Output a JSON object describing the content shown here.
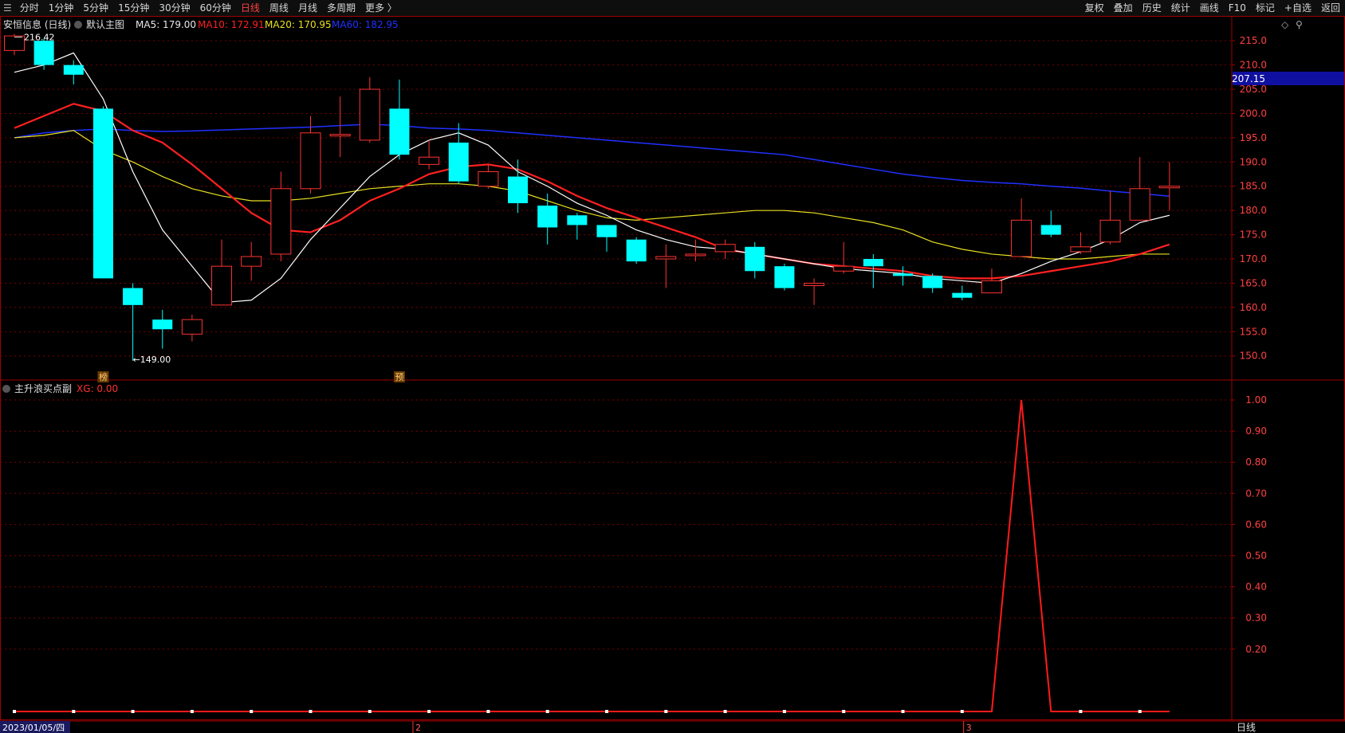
{
  "toolbar": {
    "left_items": [
      "分时",
      "1分钟",
      "5分钟",
      "15分钟",
      "30分钟",
      "60分钟",
      "日线",
      "周线",
      "月线",
      "多周期",
      "更多 〉"
    ],
    "active_index": 6,
    "right_items": [
      "复权",
      "叠加",
      "历史",
      "统计",
      "画线",
      "F10",
      "标记",
      "+自选",
      "返回"
    ]
  },
  "main_panel": {
    "stock_label": "安恒信息 (日线)",
    "template_label": "默认主图",
    "ma5": {
      "label": "MA5: 179.00",
      "color": "#ffffff"
    },
    "ma10": {
      "label": "MA10: 172.91",
      "color": "#ff2020"
    },
    "ma20": {
      "label": "MA20: 170.95",
      "color": "#e8e020"
    },
    "ma60": {
      "label": "MA60: 182.95",
      "color": "#2030ff"
    },
    "high_label": "216.42",
    "low_label": "149.00",
    "price_tag": "207.15",
    "marker_1": "榜",
    "marker_2": "预",
    "y_ticks": [
      "215.0",
      "210.0",
      "205.0",
      "200.0",
      "195.0",
      "190.0",
      "185.0",
      "180.0",
      "175.0",
      "170.0",
      "165.0",
      "160.0",
      "155.0",
      "150.0"
    ]
  },
  "sub_panel": {
    "indicator_label": "主升浪买点副",
    "xg_label": "XG: 0.00",
    "y_ticks": [
      "1.00",
      "0.90",
      "0.80",
      "0.70",
      "0.60",
      "0.50",
      "0.40",
      "0.30",
      "0.20"
    ]
  },
  "x_axis": {
    "start_date": "2023/01/05/四",
    "month_marks": [
      "2",
      "3"
    ],
    "period_label": "日线"
  },
  "colors": {
    "up": "#ff3232",
    "down": "#00ffff",
    "grid": "#7a0000",
    "axis_border": "#a00000",
    "signal": "#ff1a1a"
  },
  "chart_data": {
    "type": "candlestick",
    "y_range": [
      147,
      217
    ],
    "candles": [
      {
        "o": 213.0,
        "c": 216.0,
        "h": 216.42,
        "l": 212.0
      },
      {
        "o": 215.0,
        "c": 210.0,
        "h": 215.5,
        "l": 209.0
      },
      {
        "o": 210.0,
        "c": 208.0,
        "h": 211.0,
        "l": 206.0
      },
      {
        "o": 201.0,
        "c": 166.0,
        "h": 201.5,
        "l": 166.0
      },
      {
        "o": 164.0,
        "c": 160.5,
        "h": 165.0,
        "l": 149.0
      },
      {
        "o": 157.5,
        "c": 155.5,
        "h": 159.5,
        "l": 151.5
      },
      {
        "o": 154.5,
        "c": 157.5,
        "h": 158.5,
        "l": 153.0
      },
      {
        "o": 160.5,
        "c": 168.5,
        "h": 174.0,
        "l": 160.5
      },
      {
        "o": 168.5,
        "c": 170.5,
        "h": 173.5,
        "l": 165.5
      },
      {
        "o": 171.0,
        "c": 184.5,
        "h": 188.0,
        "l": 169.5
      },
      {
        "o": 184.5,
        "c": 196.0,
        "h": 199.5,
        "l": 183.5
      },
      {
        "o": 195.7,
        "c": 195.7,
        "h": 203.5,
        "l": 191.0
      },
      {
        "o": 194.5,
        "c": 205.0,
        "h": 207.5,
        "l": 194.0
      },
      {
        "o": 201.0,
        "c": 191.5,
        "h": 207.0,
        "l": 190.5
      },
      {
        "o": 189.5,
        "c": 191.0,
        "h": 194.5,
        "l": 188.5
      },
      {
        "o": 194.0,
        "c": 186.0,
        "h": 198.0,
        "l": 185.5
      },
      {
        "o": 185.0,
        "c": 188.0,
        "h": 189.5,
        "l": 184.5
      },
      {
        "o": 187.0,
        "c": 181.5,
        "h": 190.5,
        "l": 179.5
      },
      {
        "o": 181.0,
        "c": 176.5,
        "h": 183.5,
        "l": 173.0
      },
      {
        "o": 179.0,
        "c": 177.0,
        "h": 179.5,
        "l": 174.0
      },
      {
        "o": 177.0,
        "c": 174.5,
        "h": 177.0,
        "l": 171.5
      },
      {
        "o": 174.0,
        "c": 169.5,
        "h": 174.5,
        "l": 169.0
      },
      {
        "o": 170.0,
        "c": 170.5,
        "h": 173.0,
        "l": 164.0
      },
      {
        "o": 171.0,
        "c": 171.0,
        "h": 174.0,
        "l": 169.5
      },
      {
        "o": 171.5,
        "c": 173.0,
        "h": 174.0,
        "l": 170.0
      },
      {
        "o": 172.5,
        "c": 167.5,
        "h": 173.5,
        "l": 166.0
      },
      {
        "o": 168.5,
        "c": 164.0,
        "h": 169.0,
        "l": 163.5
      },
      {
        "o": 164.5,
        "c": 165.0,
        "h": 166.0,
        "l": 160.5
      },
      {
        "o": 167.5,
        "c": 168.5,
        "h": 173.5,
        "l": 167.0
      },
      {
        "o": 170.0,
        "c": 168.5,
        "h": 171.0,
        "l": 164.0
      },
      {
        "o": 167.0,
        "c": 166.5,
        "h": 168.5,
        "l": 164.5
      },
      {
        "o": 166.5,
        "c": 164.0,
        "h": 167.0,
        "l": 163.0
      },
      {
        "o": 163.0,
        "c": 162.0,
        "h": 164.5,
        "l": 161.5
      },
      {
        "o": 163.0,
        "c": 165.5,
        "h": 168.0,
        "l": 163.0
      },
      {
        "o": 170.5,
        "c": 178.0,
        "h": 182.5,
        "l": 170.5
      },
      {
        "o": 177.0,
        "c": 175.0,
        "h": 180.0,
        "l": 174.5
      },
      {
        "o": 171.5,
        "c": 172.5,
        "h": 175.5,
        "l": 171.0
      },
      {
        "o": 173.5,
        "c": 178.0,
        "h": 184.0,
        "l": 173.0
      },
      {
        "o": 178.0,
        "c": 184.5,
        "h": 191.0,
        "l": 178.0
      },
      {
        "o": 185.0,
        "c": 185.0,
        "h": 190.0,
        "l": 180.0
      }
    ],
    "ma5": [
      208.5,
      210.0,
      212.5,
      203.0,
      188.0,
      176.0,
      168.5,
      161.0,
      161.5,
      166.0,
      174.0,
      180.5,
      187.0,
      191.5,
      194.5,
      196.0,
      193.5,
      188.0,
      185.0,
      181.5,
      179.0,
      176.0,
      174.0,
      172.5,
      172.0,
      171.0,
      170.0,
      169.0,
      168.0,
      167.5,
      167.0,
      166.0,
      165.5,
      165.0,
      167.0,
      169.5,
      171.5,
      174.0,
      177.5,
      179.0
    ],
    "ma10": [
      197.0,
      199.5,
      202.0,
      200.5,
      196.5,
      194.0,
      189.5,
      184.5,
      179.5,
      176.0,
      175.5,
      178.0,
      182.0,
      184.5,
      187.5,
      189.0,
      189.5,
      188.5,
      186.0,
      183.0,
      180.5,
      178.5,
      176.5,
      174.5,
      172.0,
      171.0,
      170.0,
      169.0,
      168.5,
      168.0,
      167.5,
      166.5,
      166.0,
      166.0,
      166.5,
      167.5,
      168.5,
      169.5,
      171.0,
      173.0
    ],
    "ma20": [
      195.0,
      195.5,
      196.5,
      192.5,
      190.0,
      187.0,
      184.5,
      183.0,
      182.0,
      182.0,
      182.5,
      183.5,
      184.5,
      185.0,
      185.5,
      185.5,
      185.0,
      184.0,
      182.0,
      180.0,
      178.5,
      178.0,
      178.5,
      179.0,
      179.5,
      180.0,
      180.0,
      179.5,
      178.5,
      177.5,
      176.0,
      173.5,
      172.0,
      171.0,
      170.5,
      170.0,
      170.0,
      170.5,
      171.0,
      171.0
    ],
    "ma60": [
      195.0,
      196.0,
      196.5,
      196.8,
      196.5,
      196.3,
      196.4,
      196.6,
      196.8,
      197.0,
      197.2,
      197.5,
      197.8,
      197.5,
      197.0,
      196.8,
      196.5,
      196.0,
      195.5,
      195.0,
      194.5,
      194.0,
      193.5,
      193.0,
      192.5,
      192.0,
      191.5,
      190.5,
      189.5,
      188.5,
      187.5,
      186.8,
      186.2,
      185.8,
      185.5,
      185.0,
      184.6,
      184.0,
      183.5,
      182.95
    ],
    "xg_signal": [
      0,
      0,
      0,
      0,
      0,
      0,
      0,
      0,
      0,
      0,
      0,
      0,
      0,
      0,
      0,
      0,
      0,
      0,
      0,
      0,
      0,
      0,
      0,
      0,
      0,
      0,
      0,
      0,
      0,
      0,
      0,
      0,
      0,
      0,
      1,
      0,
      0,
      0,
      0,
      0
    ]
  }
}
